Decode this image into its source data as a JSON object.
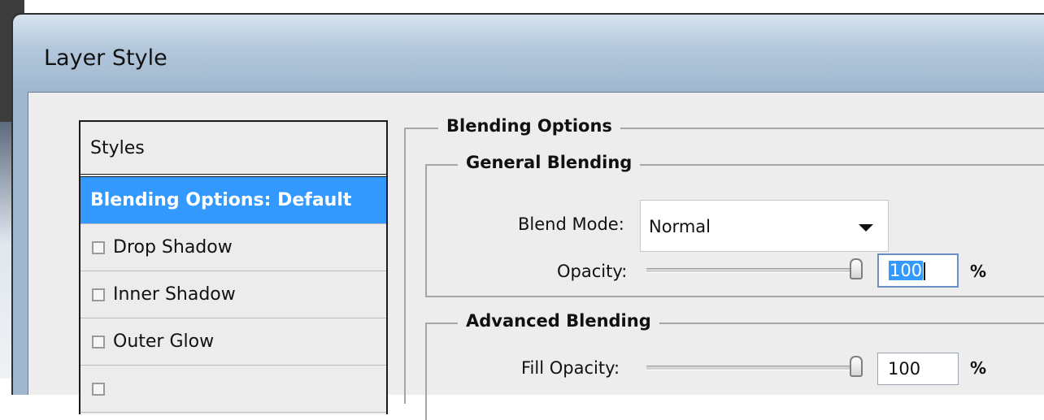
{
  "window": {
    "title": "Layer Style"
  },
  "styles_panel": {
    "header": "Styles",
    "items": [
      {
        "label": "Blending Options: Default",
        "selected": true,
        "has_checkbox": false
      },
      {
        "label": "Drop Shadow",
        "checked": false,
        "has_checkbox": true
      },
      {
        "label": "Inner Shadow",
        "checked": false,
        "has_checkbox": true
      },
      {
        "label": "Outer Glow",
        "checked": false,
        "has_checkbox": true
      },
      {
        "label": "",
        "checked": false,
        "has_checkbox": true
      }
    ]
  },
  "blending_options": {
    "title": "Blending Options",
    "general": {
      "title": "General Blending",
      "blend_mode_label": "Blend Mode:",
      "blend_mode_value": "Normal",
      "opacity_label": "Opacity:",
      "opacity_value": "100",
      "opacity_unit": "%",
      "opacity_slider": 1.0
    },
    "advanced": {
      "title": "Advanced Blending",
      "fill_opacity_label": "Fill Opacity:",
      "fill_opacity_value": "100",
      "fill_opacity_unit": "%",
      "fill_opacity_slider": 1.0
    }
  },
  "colors": {
    "selection": "#3399ff",
    "dialog_bg": "#ededed"
  }
}
